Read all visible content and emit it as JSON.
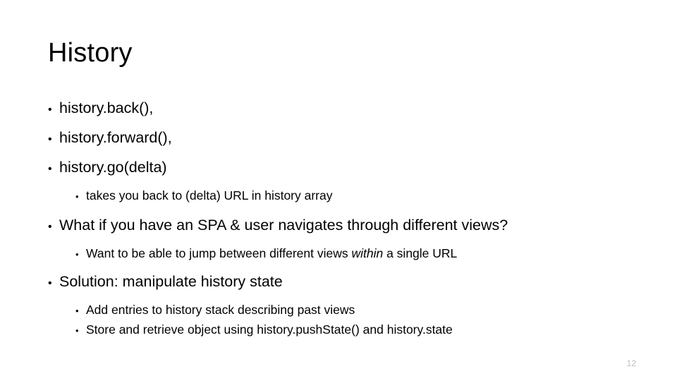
{
  "slide": {
    "title": "History",
    "page_number": "12",
    "page_number_color": "#bfbfbf",
    "background_color": "#ffffff",
    "text_color": "#000000",
    "bullet_glyph": "•",
    "blocks": [
      {
        "level": 1,
        "text": "history.back(),"
      },
      {
        "level": 1,
        "text": "history.forward(),"
      },
      {
        "level": 1,
        "text": "history.go(delta)"
      },
      {
        "level": 2,
        "text": "takes you back to (delta) URL in history array"
      },
      {
        "level": 1,
        "text": "What if you have an SPA & user navigates through different views?"
      },
      {
        "level": 2,
        "text_before": "Want to be able to jump between different views ",
        "text_emphasis": "within",
        "text_after": " a single URL"
      },
      {
        "level": 1,
        "text": "Solution: manipulate history state"
      },
      {
        "level": 2,
        "text": "Add entries to history stack describing past views"
      },
      {
        "level": 2,
        "text": "Store and retrieve object using history.pushState() and history.state"
      }
    ]
  }
}
